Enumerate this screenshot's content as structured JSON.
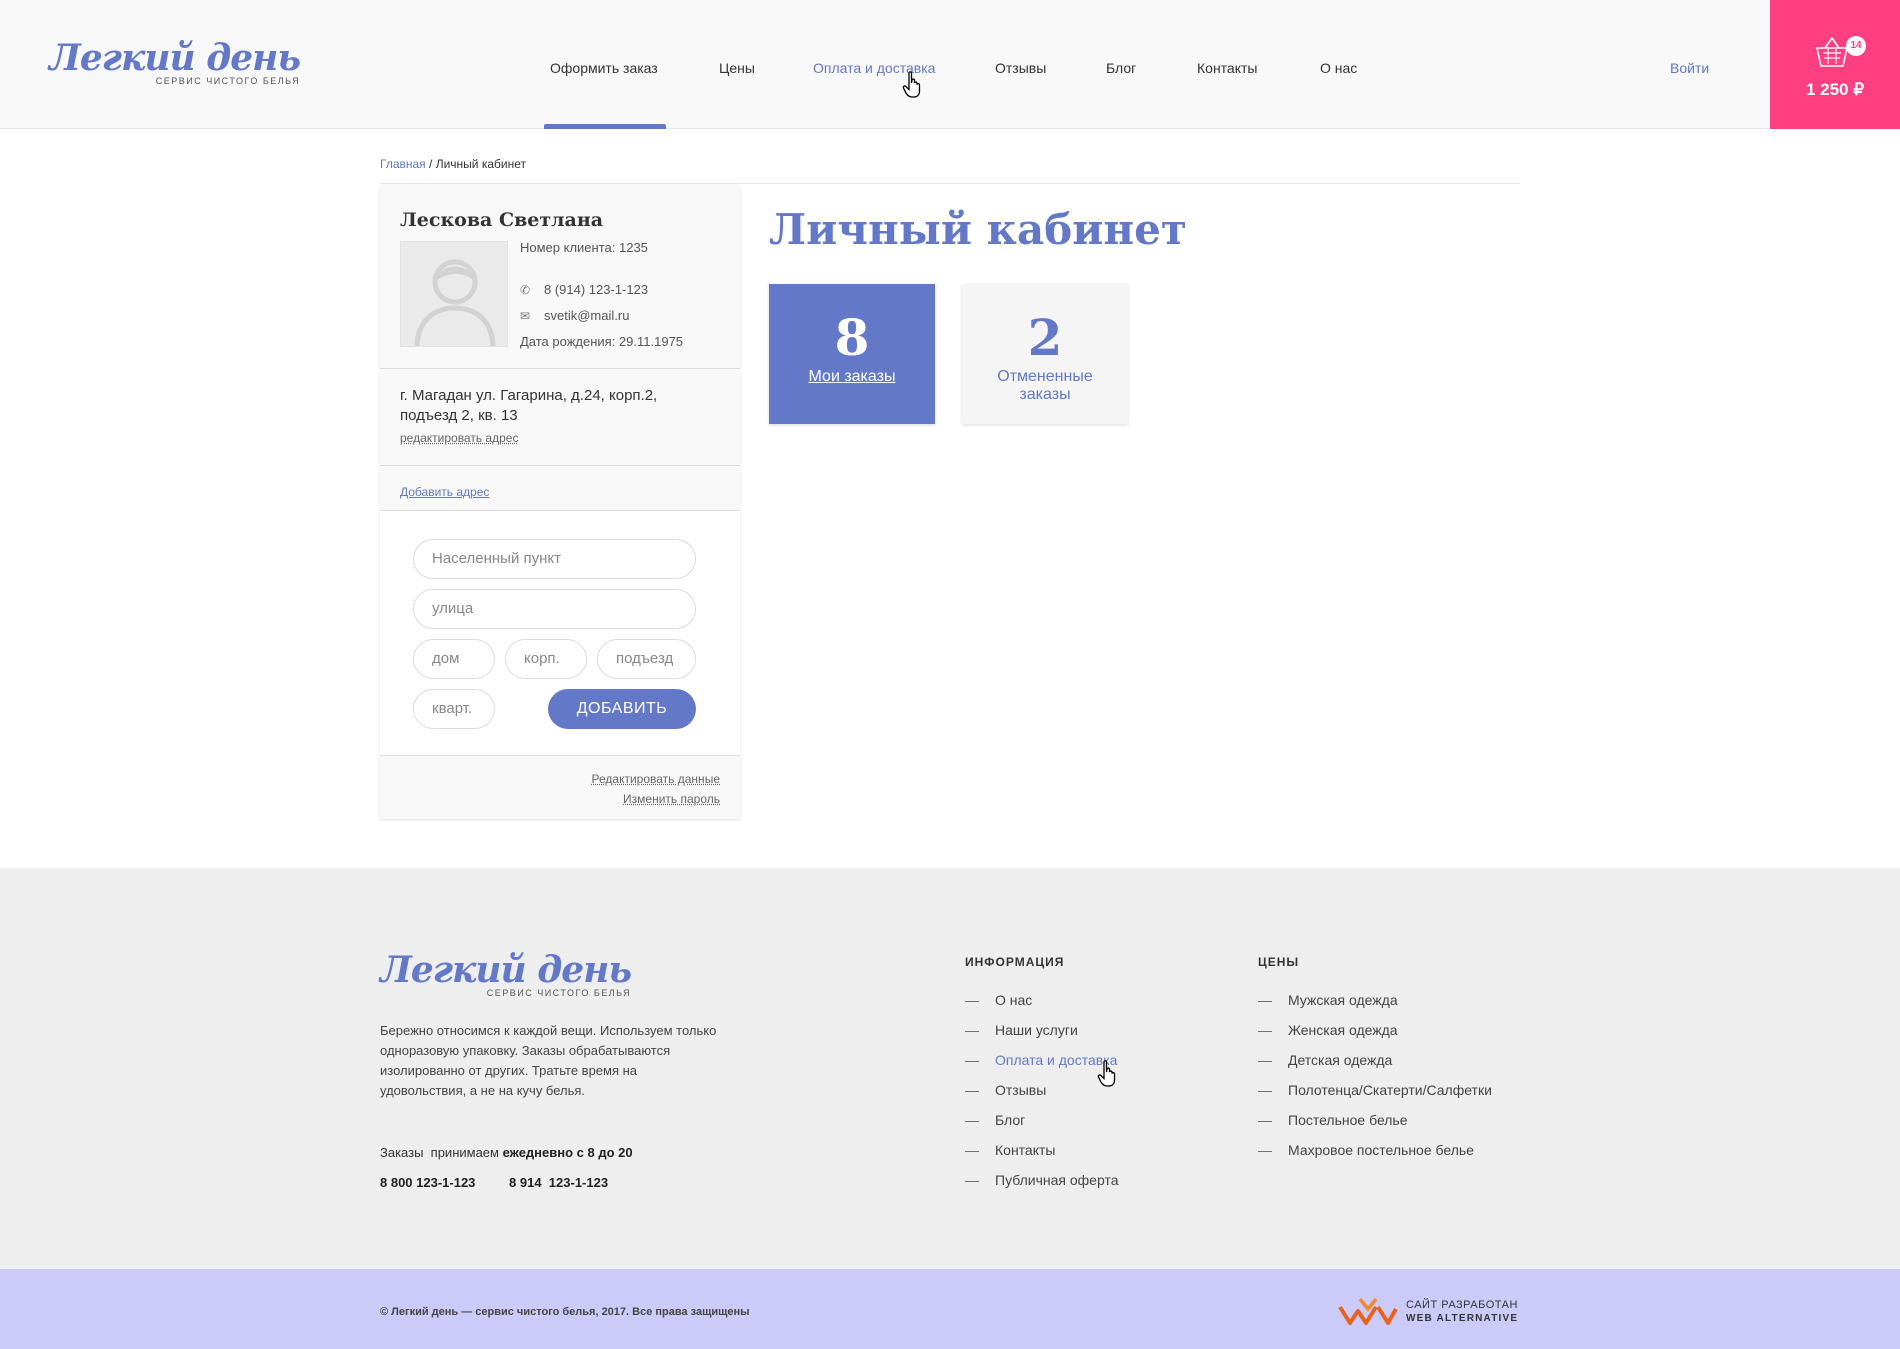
{
  "brand": {
    "name": "Легкий день",
    "tagline": "СЕРВИС ЧИСТОГО БЕЛЬЯ"
  },
  "nav": {
    "items": [
      "Оформить заказ",
      "Цены",
      "Оплата и доставка",
      "Отзывы",
      "Блог",
      "Контакты",
      "О нас"
    ],
    "login": "Войти"
  },
  "cart": {
    "count": "14",
    "total": "1 250 ₽"
  },
  "breadcrumb": {
    "home": "Главная",
    "separator": " / ",
    "current": "Личный кабинет"
  },
  "profile": {
    "name": "Лескова Светлана",
    "client_number": "Номер клиента: 1235",
    "phone": "8 (914) 123-1-123",
    "email": "svetik@mail.ru",
    "birthdate": "Дата рождения: 29.11.1975",
    "address_line1": "г. Магадан ул. Гагарина, д.24, корп.2,",
    "address_line2": "подъезд 2, кв. 13",
    "edit_address": "редактировать адрес",
    "add_address": "Добавить адрес",
    "edit_data": "Редактировать данные",
    "change_password": "Изменить пароль"
  },
  "address_form": {
    "city_placeholder": "Населенный пункт",
    "street_placeholder": "улица",
    "house_placeholder": "дом",
    "building_placeholder": "корп.",
    "entrance_placeholder": "подъезд",
    "apartment_placeholder": "кварт.",
    "submit_label": "ДОБАВИТЬ"
  },
  "main": {
    "title": "Личный кабинет",
    "tiles": [
      {
        "number": "8",
        "label": "Мои заказы"
      },
      {
        "number": "2",
        "label_line1": "Отмененные",
        "label_line2": "заказы"
      }
    ]
  },
  "footer": {
    "description": "Бережно относимся к каждой вещи. Используем только одноразовую упаковку.  Заказы обрабатываются изолированно от других. Тратьте время на удовольствия, а не на кучу белья.",
    "hours_prefix": "Заказы  принимаем ",
    "hours_value": "ежедневно с 8 до 20",
    "phone1": "8 800 123-1-123",
    "phone2": "8 914  123-1-123",
    "info_title": "ИНФОРМАЦИЯ",
    "info_items": [
      "О нас",
      "Наши услуги",
      "Оплата и доставка",
      "Отзывы",
      "Блог",
      "Контакты",
      "Публичная оферта"
    ],
    "prices_title": "ЦЕНЫ",
    "prices_items": [
      "Мужская одежда",
      "Женская одежда",
      "Детская одежда",
      "Полотенца/Скатерти/Салфетки",
      "Постельное белье",
      "Махровое постельное белье"
    ],
    "dash": "—"
  },
  "bottom": {
    "copyright": "© Легкий день — сервис чистого белья, 2017. Все права защищены",
    "dev_line1": "САЙТ РАЗРАБОТАН",
    "dev_line2": "WEB ALTERNATIVE"
  },
  "colors": {
    "accent": "#6379c8",
    "cart": "#ff3f7f",
    "bottom_bar": "#cccaf9",
    "footer": "#eeeeee"
  }
}
